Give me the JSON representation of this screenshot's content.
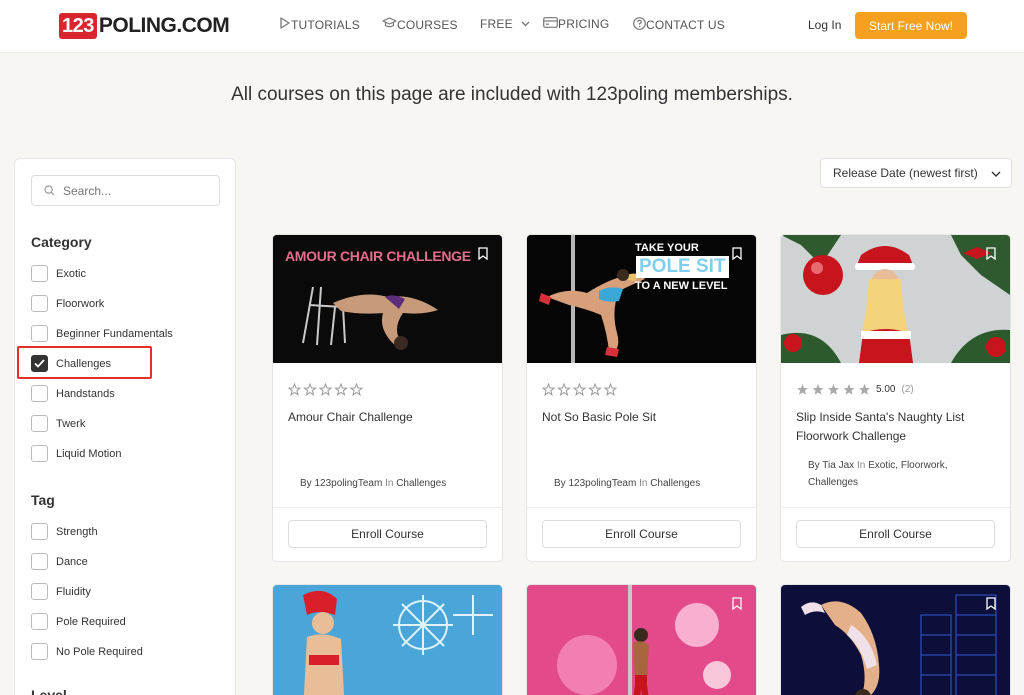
{
  "header": {
    "logo_badge": "123",
    "logo_text": "POLING.COM",
    "nav": [
      {
        "label": "TUTORIALS",
        "icon": "play-icon"
      },
      {
        "label": "COURSES",
        "icon": "graduation-cap-icon"
      },
      {
        "label": "FREE",
        "icon": "chevron-down-icon"
      },
      {
        "label": "PRICING",
        "icon": "credit-card-icon"
      },
      {
        "label": "CONTACT US",
        "icon": "question-circle-icon"
      }
    ],
    "login": "Log In",
    "cta": "Start Free Now!"
  },
  "headline": "All courses on this page are included with 123poling memberships.",
  "sidebar": {
    "search_placeholder": "Search...",
    "category_title": "Category",
    "categories": [
      {
        "label": "Exotic",
        "checked": false
      },
      {
        "label": "Floorwork",
        "checked": false
      },
      {
        "label": "Beginner Fundamentals",
        "checked": false
      },
      {
        "label": "Challenges",
        "checked": true
      },
      {
        "label": "Handstands",
        "checked": false
      },
      {
        "label": "Twerk",
        "checked": false
      },
      {
        "label": "Liquid Motion",
        "checked": false
      }
    ],
    "tag_title": "Tag",
    "tags": [
      {
        "label": "Strength",
        "checked": false
      },
      {
        "label": "Dance",
        "checked": false
      },
      {
        "label": "Fluidity",
        "checked": false
      },
      {
        "label": "Pole Required",
        "checked": false
      },
      {
        "label": "No Pole Required",
        "checked": false
      }
    ],
    "level_title": "Level"
  },
  "sort": {
    "selected": "Release Date (newest first)"
  },
  "courses": [
    {
      "title": "Amour Chair Challenge",
      "thumb_text": "AMOUR CHAIR CHALLENGE",
      "rating": 0,
      "rating_value": "",
      "rating_count": "",
      "by_label": "By",
      "author": "123polingTeam",
      "in_label": "In",
      "categories": "Challenges",
      "enroll": "Enroll Course"
    },
    {
      "title": "Not So Basic Pole Sit",
      "thumb_text_1": "TAKE YOUR",
      "thumb_text_2": "POLE SIT",
      "thumb_text_3": "TO A NEW LEVEL",
      "rating": 0,
      "rating_value": "",
      "rating_count": "",
      "by_label": "By",
      "author": "123polingTeam",
      "in_label": "In",
      "categories": "Challenges",
      "enroll": "Enroll Course"
    },
    {
      "title": "Slip Inside Santa's Naughty List Floorwork Challenge",
      "rating": 5,
      "rating_value": "5.00",
      "rating_count": "(2)",
      "by_label": "By",
      "author": "Tia Jax",
      "in_label": "In",
      "categories": "Exotic, Floorwork, Challenges",
      "enroll": "Enroll Course"
    }
  ],
  "colors": {
    "accent": "#f5a01e",
    "logo_red": "#d9262e",
    "highlight_red": "#e0322a",
    "star_filled": "#aaaaaa",
    "page_bg": "#f8f6f3"
  }
}
